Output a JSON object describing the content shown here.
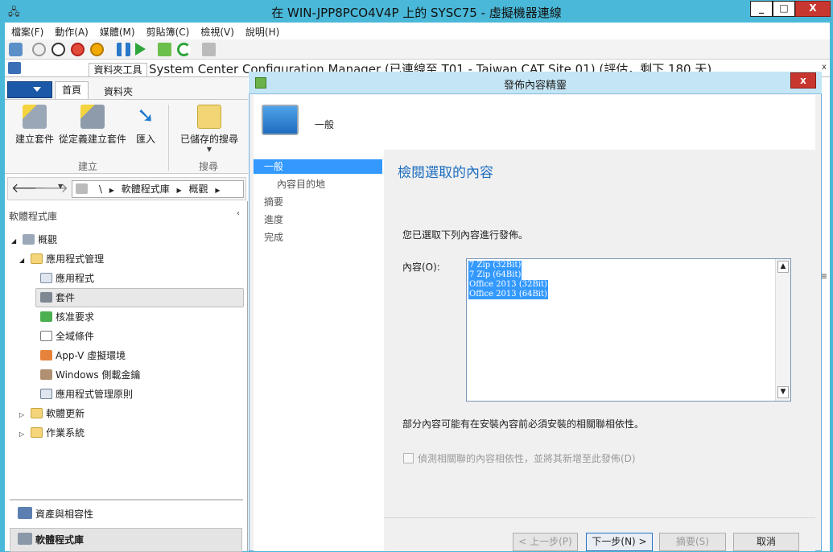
{
  "vm": {
    "title": "在 WIN-JPP8PCO4V4P 上的 SYSC75 - 虛擬機器連線",
    "minimize": "_",
    "maximize": "□",
    "close": "X"
  },
  "menu": [
    "檔案(F)",
    "動作(A)",
    "媒體(M)",
    "剪貼簿(C)",
    "檢視(V)",
    "說明(H)"
  ],
  "toolbar_icons": [
    "ctrl-alt-del-icon",
    "start-icon",
    "stop-icon",
    "shutdown-icon",
    "power-icon",
    "pause-icon",
    "resume-icon",
    "checkpoint-icon",
    "revert-icon",
    "enhanced-session-icon"
  ],
  "app": {
    "context_tab": "資料夾工具",
    "title": "System Center Configuration Manager (已連線至 T01 - Taiwan CAT Site 01) (評估，剩下 180 天)",
    "tabs": [
      "首頁",
      "資料夾"
    ],
    "ribbon_buttons": [
      "建立套件",
      "從定義建立套件",
      "匯入",
      "已儲存的搜尋"
    ],
    "ribbon_groups": [
      "建立",
      "搜尋"
    ],
    "breadcrumb": [
      "\\",
      "軟體程式庫",
      "概觀"
    ],
    "workspace_title": "軟體程式庫",
    "tree": [
      "概觀",
      "應用程式管理",
      "應用程式",
      "套件",
      "核准要求",
      "全域條件",
      "App-V 虛擬環境",
      "Windows 側載金鑰",
      "應用程式管理原則",
      "軟體更新",
      "作業系統"
    ],
    "bottom_nav": [
      "資產與相容性",
      "軟體程式庫"
    ]
  },
  "dialog": {
    "title": "發佈內容精靈",
    "close": "x",
    "header_title": "一般",
    "steps": [
      "一般",
      "內容目的地",
      "摘要",
      "進度",
      "完成"
    ],
    "heading": "檢閱選取的內容",
    "intro": "您已選取下列內容進行發佈。",
    "content_label": "內容(O):",
    "content_items": [
      "7 Zip (32Bit)",
      "7 Zip (64Bit)",
      "Office 2013 (32Bit)",
      "Office 2013 (64Bit)"
    ],
    "dependency_note": "部分內容可能有在安裝內容前必須安裝的相關聯相依性。",
    "checkbox_label": "偵測相關聯的內容相依性，並將其新增至此發佈(D)",
    "checkbox_checked": false,
    "buttons": [
      "< 上一步(P)",
      "下一步(N) >",
      "摘要(S)",
      "取消"
    ]
  }
}
